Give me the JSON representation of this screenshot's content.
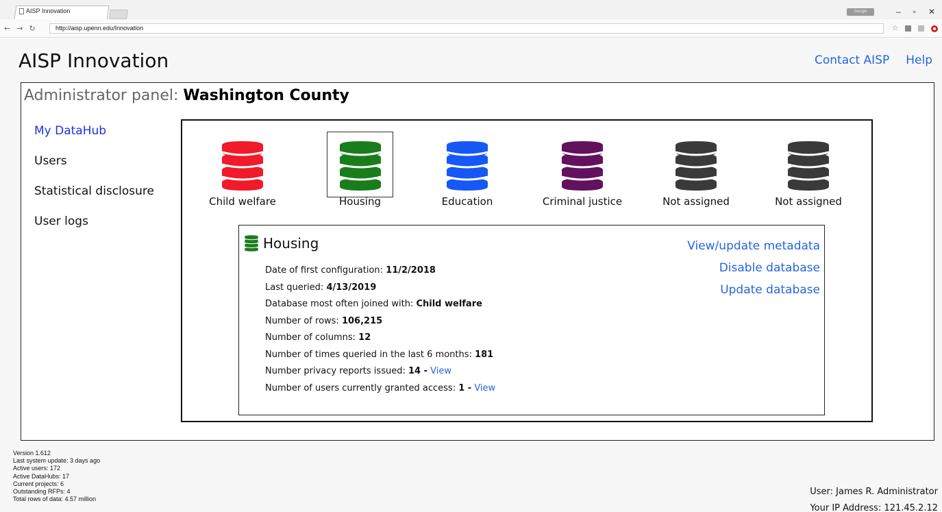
{
  "browser": {
    "tab_title": "AISP Innovation",
    "url": "http://aisp.upenn.edu/Innovation"
  },
  "header": {
    "app_title": "AISP Innovation",
    "links": [
      "Contact AISP",
      "Help"
    ]
  },
  "panel": {
    "label": "Administrator panel:",
    "county": "Washington County"
  },
  "sidebar": {
    "items": [
      {
        "label": "My DataHub",
        "active": true
      },
      {
        "label": "Users",
        "active": false
      },
      {
        "label": "Statistical disclosure",
        "active": false
      },
      {
        "label": "User logs",
        "active": false
      }
    ]
  },
  "databases": [
    {
      "label": "Child welfare",
      "color": "#f01a2a",
      "selected": false
    },
    {
      "label": "Housing",
      "color": "#1a7d1c",
      "selected": true
    },
    {
      "label": "Education",
      "color": "#1558f5",
      "selected": false
    },
    {
      "label": "Criminal justice",
      "color": "#63105f",
      "selected": false
    },
    {
      "label": "Not assigned",
      "color": "#3a3a3a",
      "selected": false
    },
    {
      "label": "Not assigned",
      "color": "#3a3a3a",
      "selected": false
    }
  ],
  "detail": {
    "title": "Housing",
    "icon_color": "#1a7d1c",
    "stats": [
      {
        "label": "Date of first configuration:",
        "value": "11/2/2018"
      },
      {
        "label": "Last queried:",
        "value": "4/13/2019"
      },
      {
        "label": "Database most often joined with:",
        "value": "Child welfare"
      },
      {
        "label": "Number of rows:",
        "value": "106,215"
      },
      {
        "label": "Number of columns:",
        "value": "12"
      },
      {
        "label": "Number of times queried in the last 6 months:",
        "value": "181"
      },
      {
        "label": "Number privacy reports issued:",
        "value": "14 -",
        "link": "View"
      },
      {
        "label": "Number of users currently granted access:",
        "value": "1 -",
        "link": "View"
      }
    ],
    "actions": [
      "View/update metadata",
      "Disable database",
      "Update database"
    ]
  },
  "footer": {
    "system_info": [
      "Version 1.612",
      "Last system update: 3 days ago",
      "Active users: 172",
      "Active DataHubs: 17",
      "Current projects: 6",
      "Outstanding RFPs: 4",
      "Total rows of data: 4.57 million"
    ],
    "user": "User: James R. Administrator",
    "ip": "Your IP Address: 121.45.2.12"
  }
}
